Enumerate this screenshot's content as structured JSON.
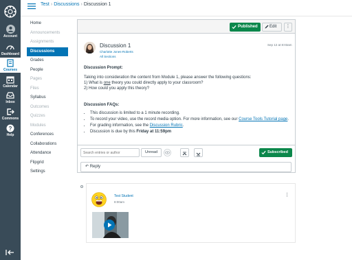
{
  "global_nav": {
    "items": [
      {
        "label": "Account",
        "icon": "account-icon"
      },
      {
        "label": "Dashboard",
        "icon": "dashboard-icon"
      },
      {
        "label": "Courses",
        "icon": "courses-icon"
      },
      {
        "label": "Calendar",
        "icon": "calendar-icon"
      },
      {
        "label": "Inbox",
        "icon": "inbox-icon"
      },
      {
        "label": "Commons",
        "icon": "commons-icon"
      },
      {
        "label": "Help",
        "icon": "help-icon"
      }
    ]
  },
  "breadcrumbs": [
    "Test",
    "Discussions",
    "Discussion 1"
  ],
  "course_nav": [
    {
      "label": "Home"
    },
    {
      "label": "Announcements"
    },
    {
      "label": "Assignments"
    },
    {
      "label": "Discussions"
    },
    {
      "label": "Grades"
    },
    {
      "label": "People"
    },
    {
      "label": "Pages"
    },
    {
      "label": "Files"
    },
    {
      "label": "Syllabus"
    },
    {
      "label": "Outcomes"
    },
    {
      "label": "Quizzes"
    },
    {
      "label": "Modules"
    },
    {
      "label": "Conferences"
    },
    {
      "label": "Collaborations"
    },
    {
      "label": "Attendance"
    },
    {
      "label": "Flipgrid"
    },
    {
      "label": "Settings"
    }
  ],
  "topic": {
    "published_label": "Published",
    "edit_label": "Edit",
    "more_label": "⋮",
    "title": "Discussion 1",
    "author": "Charlotte Jones-Roberts",
    "sections": "All Sections",
    "date": "Sep 12 at 8:03am",
    "prompt_heading": "Discussion Prompt:",
    "prompt_line1": "Taking into consideration the content from Module 1, please answer the following questions:",
    "prompt_line2a": "1) What is ",
    "prompt_line2b": "one",
    "prompt_line2c": " theory you could directly apply to your classroom?",
    "prompt_line3": "2) How could you apply this theory?",
    "faq_heading": "Discussion FAQs:",
    "faq1": "This discussion is limited to a 1 minute recording.",
    "faq2a": "To record your video, use the record media option. For more information, see our ",
    "faq2_link": "Course Tools Tutorial page",
    "faq2b": ".",
    "faq3a": "For grading information, see the ",
    "faq3_link": "Discussion Rubric",
    "faq3b": ".",
    "faq4a": "Discussion is due by this ",
    "faq4b": "Friday at 11:59pm"
  },
  "toolbar": {
    "search_placeholder": "Search entries or author",
    "unread_label": "Unread",
    "subscribed_label": "Subscribed"
  },
  "reply_label": "Reply",
  "entry": {
    "name": "Test Student",
    "time": "8:00am",
    "more_label": "⋮"
  },
  "colors": {
    "nav_bg": "#394b58",
    "link": "#0374b5",
    "success": "#0b874b"
  }
}
